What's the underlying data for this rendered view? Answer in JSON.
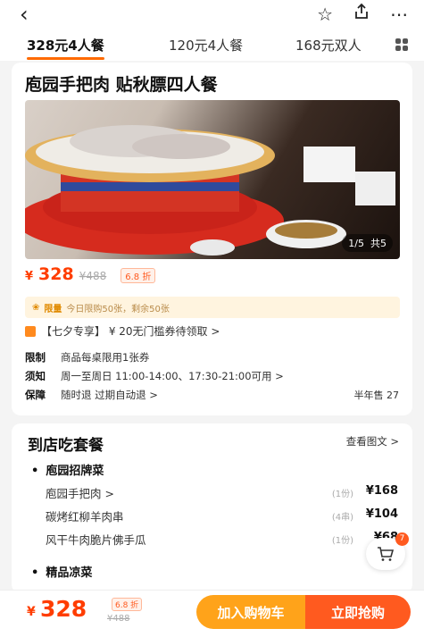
{
  "header": {
    "back_icon": "back-arrow-icon",
    "icons": [
      "star-icon",
      "share-icon",
      "more-icon"
    ]
  },
  "tabs": [
    {
      "label": "328元4人餐",
      "active": true
    },
    {
      "label": "120元4人餐",
      "active": false
    },
    {
      "label": "168元双人",
      "active": false
    }
  ],
  "product": {
    "title": "庖园手把肉 贴秋膘四人餐",
    "photo_counter": "1/5",
    "photo_total": "共5",
    "currency": "¥",
    "price": "328",
    "original_price": "¥488",
    "discount": "6.8 折",
    "limit_tag": "限量",
    "limit_text": "今日限购50张，剩余50张",
    "promo_icon": "qixi-icon",
    "promo_text": "【七夕专享】 ¥ 20无门槛券待领取 >",
    "info": [
      {
        "key": "限制",
        "value": "商品每桌限用1张券"
      },
      {
        "key": "须知",
        "value": "周一至周日 11:00-14:00、17:30-21:00可用 >"
      },
      {
        "key": "保障",
        "value": "随时退 过期自动退 >"
      }
    ],
    "sold": "半年售 27"
  },
  "package": {
    "title": "到店吃套餐",
    "link": "查看图文 >",
    "categories": [
      {
        "name": "庖园招牌菜",
        "items": [
          {
            "name": "庖园手把肉 >",
            "qty": "(1份)",
            "price": "¥168"
          },
          {
            "name": "碳烤红柳羊肉串",
            "qty": "(4串)",
            "price": "¥104"
          },
          {
            "name": "风干牛肉脆片佛手瓜",
            "qty": "(1份)",
            "price": "¥68"
          }
        ]
      },
      {
        "name": "精品凉菜",
        "items": []
      }
    ]
  },
  "cart": {
    "icon": "cart-icon",
    "badge": "7"
  },
  "bottom": {
    "currency": "¥",
    "price": "328",
    "discount": "6.8 折",
    "original_price": "¥488",
    "add_cart": "加入购物车",
    "buy_now": "立即抢购"
  },
  "colors": {
    "accent": "#ff5a1f",
    "orange": "#ffa31a",
    "price": "#ff3d00"
  }
}
